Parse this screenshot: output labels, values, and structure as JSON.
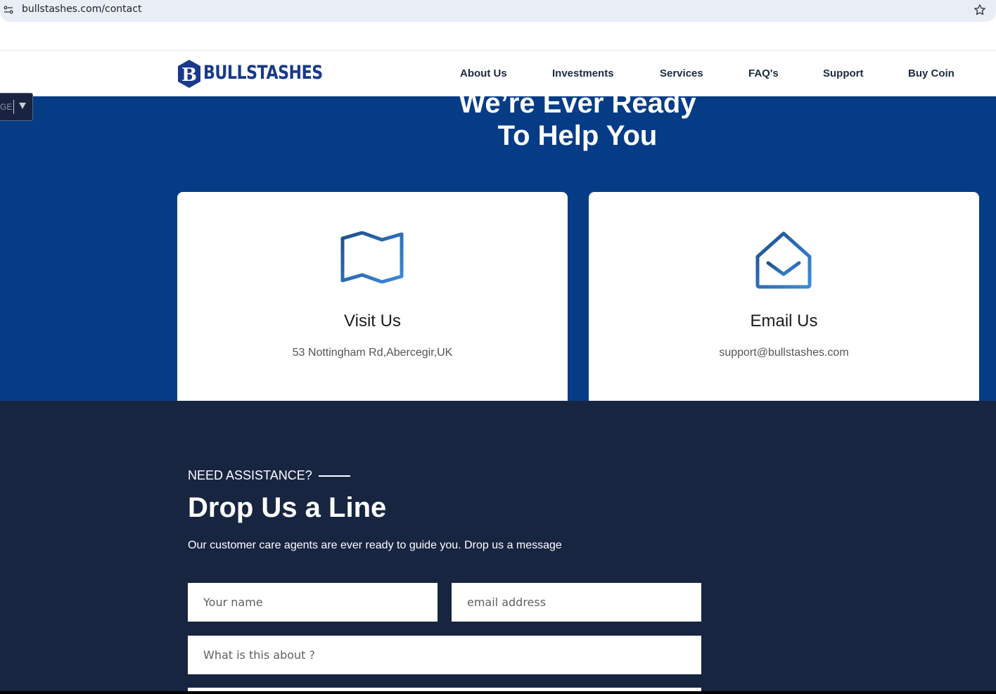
{
  "browser": {
    "url": "bullstashes.com/contact"
  },
  "header": {
    "logo_text": "BULLSTASHES",
    "nav": [
      {
        "label": "About Us"
      },
      {
        "label": "Investments"
      },
      {
        "label": "Services"
      },
      {
        "label": "FAQ's"
      },
      {
        "label": "Support"
      },
      {
        "label": "Buy Coin"
      }
    ]
  },
  "language_tab": {
    "text": "GE"
  },
  "hero": {
    "title_line1": "We’re Ever Ready",
    "title_line2": "To Help You",
    "cards": [
      {
        "icon": "map-icon",
        "title": "Visit Us",
        "text": "53 Nottingham Rd,Abercegir,UK"
      },
      {
        "icon": "envelope-open-icon",
        "title": "Email Us",
        "text": "support@bullstashes.com"
      }
    ]
  },
  "contact": {
    "eyebrow": "NEED ASSISTANCE?",
    "heading": "Drop Us a Line",
    "subtext": "Our customer care agents are ever ready to guide you. Drop us a message",
    "name_placeholder": "Your name",
    "email_placeholder": "email address",
    "subject_placeholder": "What is this about ?"
  },
  "colors": {
    "brand": "#183a8c",
    "hero_bg": "#063c86",
    "section_bg": "#172541",
    "icon_gradient_start": "#1d4f8c",
    "icon_gradient_end": "#3d8bdc"
  }
}
